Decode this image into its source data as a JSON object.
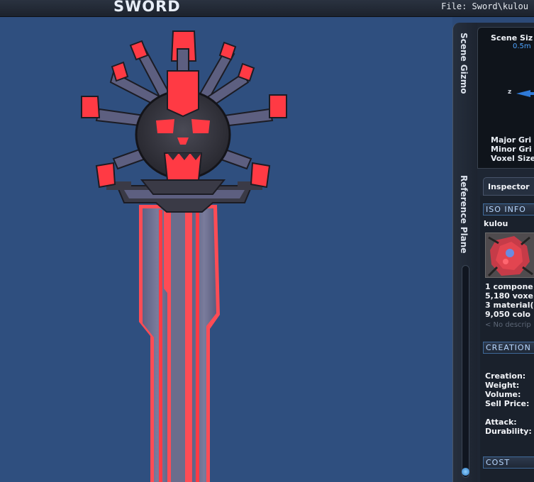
{
  "header": {
    "title": "SWORD",
    "file_label": "File: Sword\\kulou"
  },
  "side_tabs": {
    "scene_gizmo": "Scene Gizmo",
    "reference_plane": "Reference Plane"
  },
  "scene_gizmo": {
    "title": "Scene Siz",
    "scene_size_value": "0.5m",
    "axis_label": "z",
    "major_grid": "Major Gri",
    "minor_grid": "Minor Gri",
    "voxel_size": "Voxel Size"
  },
  "inspector": {
    "tab_label": "Inspector",
    "iso_info_header": "ISO INFO",
    "iso_name": "kulou",
    "stats": [
      "1 compone",
      "5,180 voxe",
      "3 material(",
      "9,050 colo"
    ],
    "description_placeholder": "< No descrip",
    "creation_header": "CREATION",
    "fields": [
      "Creation:",
      "Weight:",
      "Volume:",
      "Sell Price:"
    ],
    "combat_fields": [
      "Attack:",
      "Durability:"
    ],
    "cost_header": "COST"
  },
  "reference_plane_slider": {
    "value": 0.0
  },
  "colors": {
    "viewport_bg": "#2f4f7f",
    "accent_red": "#ff3a44",
    "metal_grey": "#6d6f8a",
    "panel_bg": "#1e2633",
    "accent_blue": "#4ea3ff"
  }
}
